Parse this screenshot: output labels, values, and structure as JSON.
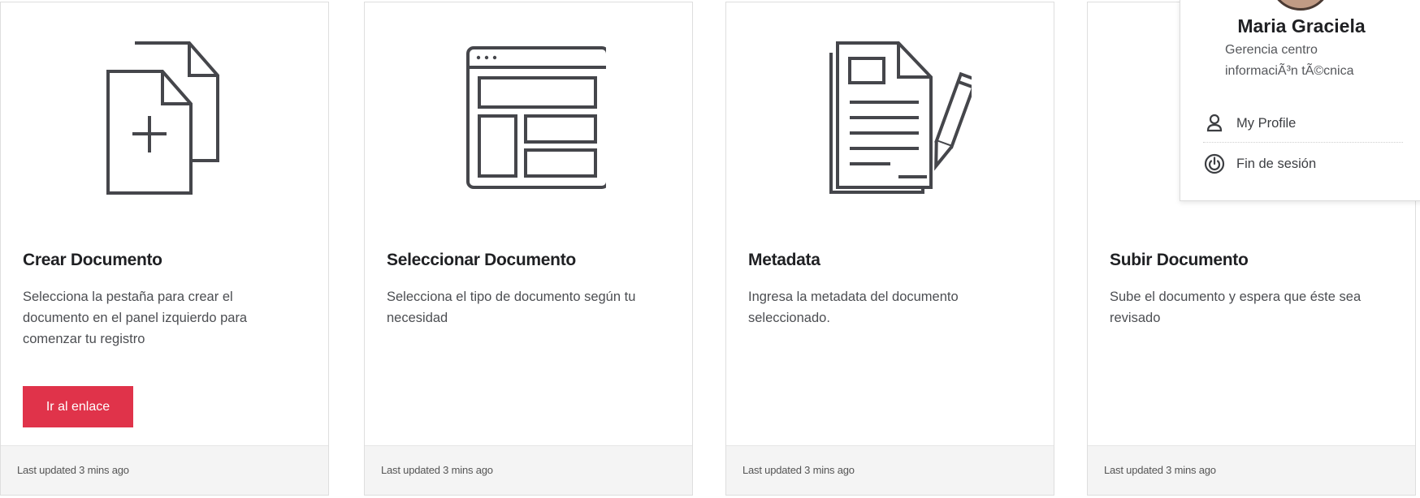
{
  "cards": [
    {
      "icon": "new-document-icon",
      "title": "Crear Documento",
      "description": "Selecciona la pestaña para crear el documento en el panel izquierdo para comenzar tu registro",
      "button_label": "Ir al enlace",
      "footer": "Last updated 3 mins ago"
    },
    {
      "icon": "layout-template-icon",
      "title": "Seleccionar Documento",
      "description": "Selecciona el tipo de documento según tu necesidad",
      "footer": "Last updated 3 mins ago"
    },
    {
      "icon": "document-edit-icon",
      "title": "Metadata",
      "description": "Ingresa la metadata del documento seleccionado.",
      "footer": "Last updated 3 mins ago"
    },
    {
      "title": "Subir Documento",
      "description": "Sube el documento y espera que éste sea revisado",
      "footer": "Last updated 3 mins ago"
    }
  ],
  "profile_menu": {
    "user_name": "Maria Graciela",
    "user_role": "Gerencia centro informaciÃ³n tÃ©cnica",
    "items": [
      {
        "icon": "user-icon",
        "label": "My Profile"
      },
      {
        "icon": "power-icon",
        "label": "Fin de sesión"
      }
    ]
  },
  "colors": {
    "accent_button": "#e0334a",
    "icon_stroke": "#45464b",
    "footer_bg": "#f4f4f4"
  }
}
